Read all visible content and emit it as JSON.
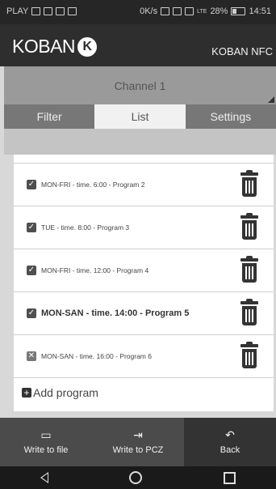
{
  "status": {
    "carrier": "PLAY",
    "speed": "0K/s",
    "battery": "28%",
    "time": "14:51",
    "network": "LTE"
  },
  "appbar": {
    "logo": "KOBAN",
    "device": "KOBAN NFC"
  },
  "channel": {
    "selected": "Channel 1"
  },
  "tabs": [
    "Filter",
    "List",
    "Settings"
  ],
  "programs": [
    {
      "text": "MON-FRI - time. 6:00 - Program 2",
      "checked": true
    },
    {
      "text": "TUE - time. 8:00 - Program 3",
      "checked": true
    },
    {
      "text": "MON-FRI - time. 12:00 - Program 4",
      "checked": true
    },
    {
      "text": "MON-SAN - time. 14:00 - Program 5",
      "checked": true
    },
    {
      "text": "MON-SAN - time. 16:00 - Program 6",
      "checked": false
    }
  ],
  "add_program": "Add program",
  "bottom": {
    "write_file": "Write to file",
    "write_pcz": "Write to PCZ",
    "back": "Back"
  },
  "colors": {
    "appbar": "#2e2e2e",
    "tabs": "#777777",
    "panel": "#ffffff",
    "bottombar": "#4b4b4b"
  }
}
